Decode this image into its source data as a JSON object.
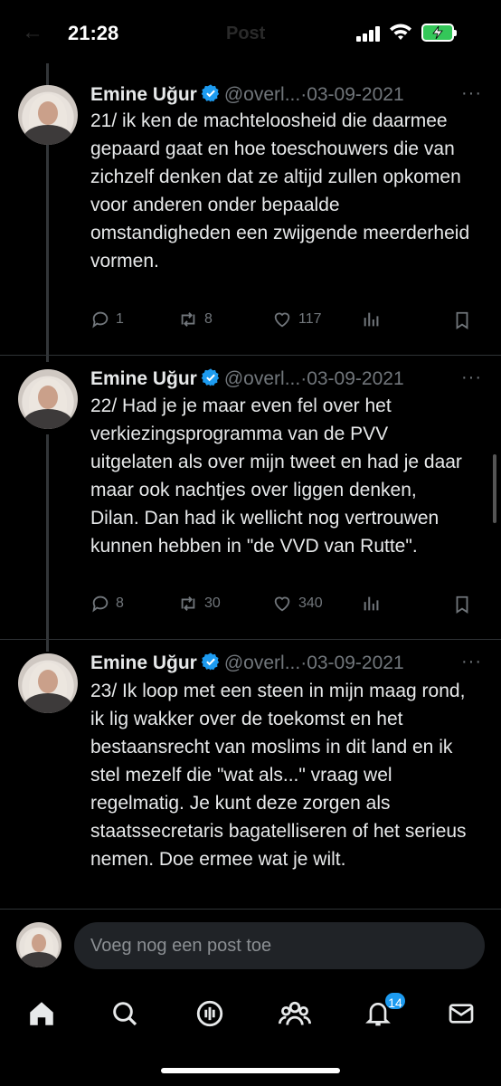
{
  "status_bar": {
    "time": "21:28",
    "ghost_title": "Post"
  },
  "tweets": [
    {
      "name": "Emine Uğur",
      "handle": "@overl...",
      "separator": "·",
      "date": "03-09-2021",
      "text": "21/ ik ken de machteloosheid die daarmee gepaard gaat en hoe toeschouwers die van zichzelf denken dat ze altijd zullen opkomen voor anderen onder bepaalde omstandigheden een zwijgende meerderheid vormen.",
      "replies": "1",
      "reposts": "8",
      "likes": "117"
    },
    {
      "name": "Emine Uğur",
      "handle": "@overl...",
      "separator": "·",
      "date": "03-09-2021",
      "text": "22/ Had je je maar even fel over het verkiezingsprogramma van de PVV uitgelaten als over mijn tweet en had je daar maar ook nachtjes over liggen denken, Dilan. Dan had ik wellicht nog vertrouwen kunnen hebben in \"de VVD van Rutte\".",
      "replies": "8",
      "reposts": "30",
      "likes": "340"
    },
    {
      "name": "Emine Uğur",
      "handle": "@overl...",
      "separator": "·",
      "date": "03-09-2021",
      "text": "23/ Ik loop met een steen in mijn maag rond, ik lig wakker over de toekomst en het bestaansrecht van moslims in dit land en ik stel mezelf die \"wat als...\" vraag wel regelmatig. Je kunt deze zorgen als staatssecretaris bagatelliseren of het serieus nemen. Doe ermee wat je wilt."
    }
  ],
  "composer": {
    "placeholder": "Voeg nog een post toe"
  },
  "nav": {
    "notifications_badge": "14"
  },
  "colors": {
    "accent": "#1d9bf0",
    "muted": "#71767b",
    "background": "#000000",
    "text": "#e7e9ea"
  },
  "icons": [
    "home-icon",
    "search-icon",
    "spaces-icon",
    "communities-icon",
    "notifications-icon",
    "messages-icon",
    "reply-icon",
    "repost-icon",
    "like-icon",
    "views-icon",
    "bookmark-icon",
    "verified-icon",
    "more-icon"
  ]
}
